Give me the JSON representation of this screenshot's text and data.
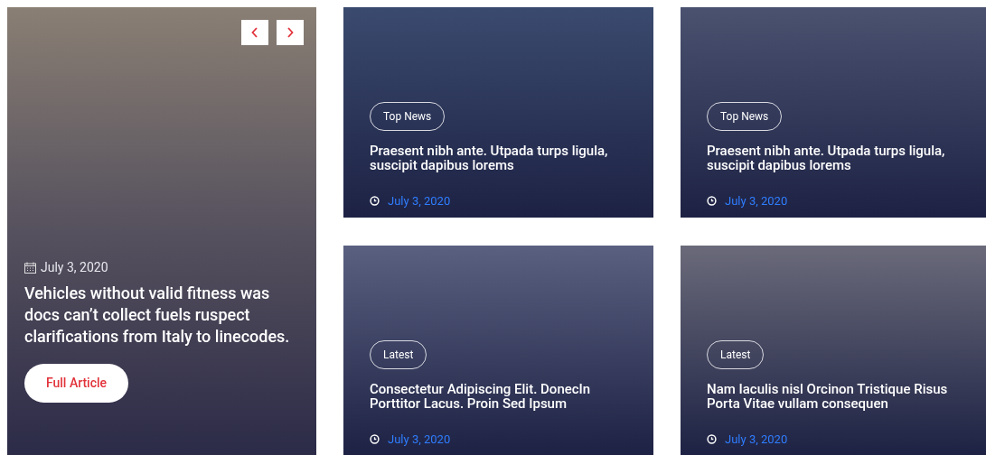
{
  "featured": {
    "date": "July 3, 2020",
    "title": "Vehicles without valid fitness was docs can’t collect fuels ruspect clarifications from Italy to linecodes.",
    "button": "Full Article"
  },
  "cards": [
    {
      "tag": "Top News",
      "title": "Praesent nibh ante. Utpada turps ligula, suscipit dapibus lorems",
      "date": "July 3, 2020",
      "color": "#3a4a6e"
    },
    {
      "tag": "Top News",
      "title": "Praesent nibh ante. Utpada turps ligula, suscipit dapibus lorems",
      "date": "July 3, 2020",
      "color": "#4a5270"
    },
    {
      "tag": "Latest",
      "title": "Consectetur Adipiscing Elit. DonecIn Porttitor Lacus. Proin Sed Ipsum",
      "date": "July 3, 2020",
      "color": "#5a6080"
    },
    {
      "tag": "Latest",
      "title": "Nam Iaculis nisl Orcinon Tristique Risus Porta Vitae vullam consequen",
      "date": "July 3, 2020",
      "color": "#6a6a7a"
    }
  ]
}
